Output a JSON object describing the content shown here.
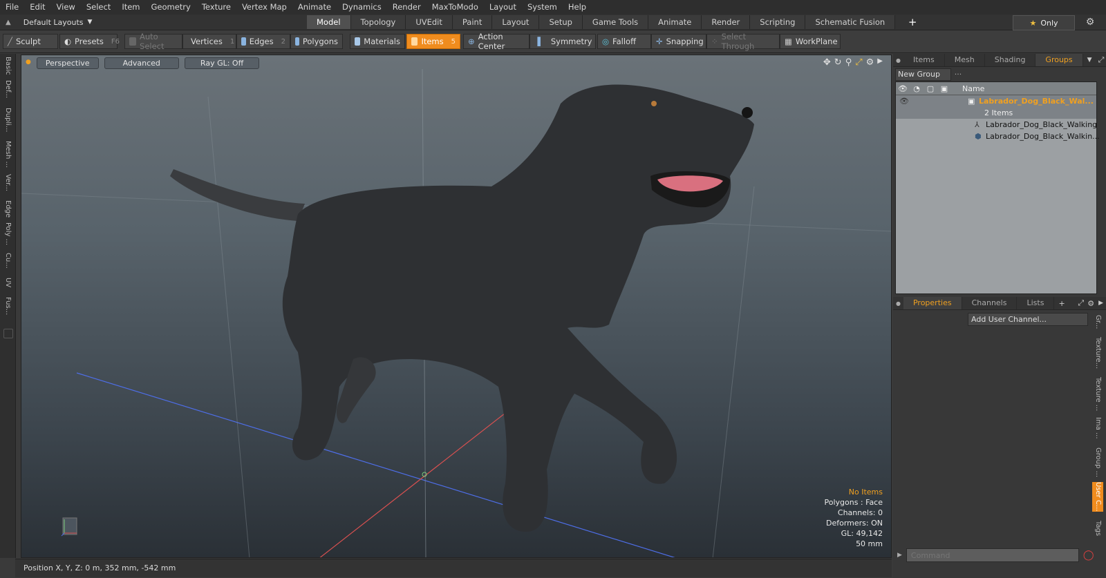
{
  "menu": [
    "File",
    "Edit",
    "View",
    "Select",
    "Item",
    "Geometry",
    "Texture",
    "Vertex Map",
    "Animate",
    "Dynamics",
    "Render",
    "MaxToModo",
    "Layout",
    "System",
    "Help"
  ],
  "layout": {
    "label": "Default Layouts"
  },
  "mode_tabs": [
    {
      "label": "Model",
      "active": true
    },
    {
      "label": "Topology"
    },
    {
      "label": "UVEdit"
    },
    {
      "label": "Paint"
    },
    {
      "label": "Layout"
    },
    {
      "label": "Setup"
    },
    {
      "label": "Game Tools"
    },
    {
      "label": "Animate"
    },
    {
      "label": "Render"
    },
    {
      "label": "Scripting"
    },
    {
      "label": "Schematic Fusion"
    }
  ],
  "only_label": "Only",
  "toolbar": {
    "sculpt": "Sculpt",
    "presets": "Presets",
    "presets_key": "F6",
    "auto_select": "Auto Select",
    "vertices": "Vertices",
    "vertices_key": "1",
    "edges": "Edges",
    "edges_key": "2",
    "polygons": "Polygons",
    "materials": "Materials",
    "items": "Items",
    "items_key": "5",
    "action_center": "Action Center",
    "symmetry": "Symmetry",
    "falloff": "Falloff",
    "snapping": "Snapping",
    "select_through": "Select Through",
    "workplane": "WorkPlane"
  },
  "left_tabs": [
    "Basic",
    "Def...",
    "Dupli...",
    "Mesh ...",
    "Ver...",
    "Edge",
    "Poly ...",
    "Cu...",
    "UV",
    "Fus..."
  ],
  "viewport": {
    "perspective": "Perspective",
    "advanced": "Advanced",
    "raygl": "Ray GL: Off",
    "info": {
      "no_items": "No Items",
      "polygons": "Polygons : Face",
      "channels": "Channels: 0",
      "deformers": "Deformers: ON",
      "gl": "GL: 49,142",
      "mm": "50 mm"
    }
  },
  "status": {
    "position": "Position X, Y, Z:   0 m, 352 mm, -542 mm"
  },
  "right_tabs": [
    {
      "label": "Items"
    },
    {
      "label": "Mesh ..."
    },
    {
      "label": "Shading"
    },
    {
      "label": "Groups",
      "active": true
    }
  ],
  "groups": {
    "new_group": "New Group",
    "name_header": "Name",
    "group_name": "Labrador_Dog_Black_Wal...",
    "group_count": "2 Items",
    "children": [
      "Labrador_Dog_Black_Walking",
      "Labrador_Dog_Black_Walkin..."
    ]
  },
  "props_tabs": [
    {
      "label": "Properties",
      "active": true
    },
    {
      "label": "Channels"
    },
    {
      "label": "Lists"
    }
  ],
  "add_user_channel": "Add User Channel...",
  "right_vtabs": [
    "Gr...",
    "Texture...",
    "Texture ...",
    "Ima ...",
    "Group ...",
    "User C...",
    "Tags"
  ],
  "command_placeholder": "Command"
}
